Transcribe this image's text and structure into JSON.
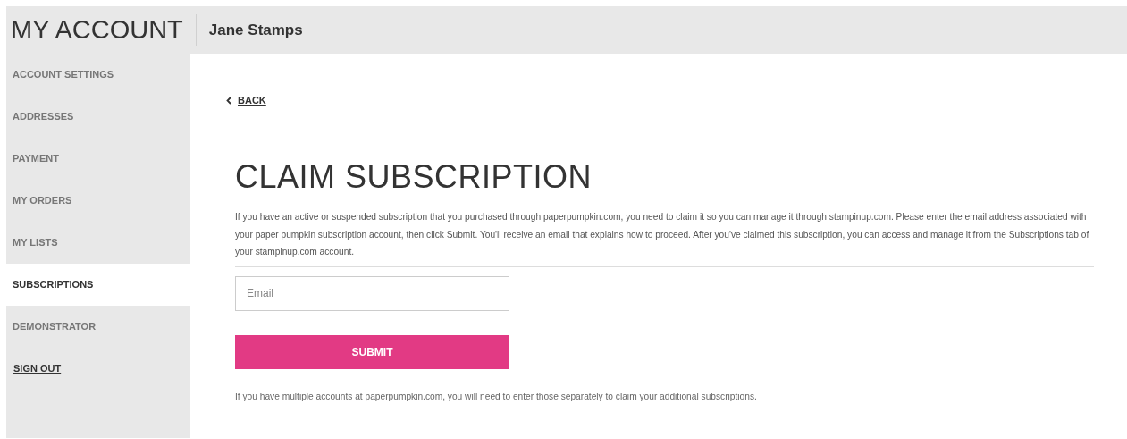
{
  "header": {
    "title": "MY ACCOUNT",
    "user_name": "Jane Stamps"
  },
  "sidebar": {
    "items": [
      {
        "label": "ACCOUNT SETTINGS",
        "kind": "section",
        "selected": false
      },
      {
        "label": "ADDRESSES",
        "kind": "section",
        "selected": false
      },
      {
        "label": "PAYMENT",
        "kind": "section",
        "selected": false
      },
      {
        "label": "MY ORDERS",
        "kind": "section",
        "selected": false
      },
      {
        "label": "MY LISTS",
        "kind": "section",
        "selected": false
      },
      {
        "label": "SUBSCRIPTIONS",
        "kind": "section",
        "selected": true
      },
      {
        "label": "DEMONSTRATOR",
        "kind": "section",
        "selected": false
      },
      {
        "label": "SIGN OUT",
        "kind": "link",
        "selected": false
      }
    ]
  },
  "main": {
    "back_link": "BACK",
    "title": "CLAIM SUBSCRIPTION",
    "intro": "If you have an active or suspended subscription that you purchased through paperpumpkin.com, you need to claim it so you can manage it through stampinup.com. Please enter the email address associated with your paper pumpkin subscription account, then click Submit. You'll receive an email that explains how to proceed. After you've claimed this subscription, you can access and manage it from the Subscriptions tab of your stampinup.com account.",
    "email_field": {
      "placeholder": "Email"
    },
    "submit_button": "SUBMIT",
    "note": "If you have multiple accounts at paperpumpkin.com, you will need to enter those separately to claim your additional subscriptions."
  }
}
